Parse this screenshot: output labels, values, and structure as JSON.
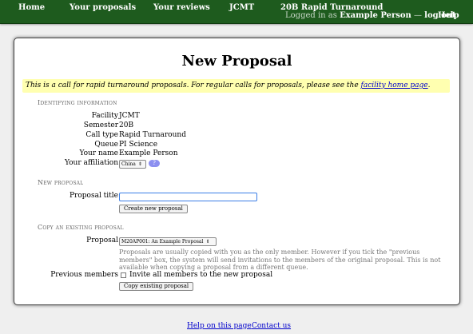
{
  "nav": {
    "home": "Home",
    "your_proposals": "Your proposals",
    "your_reviews": "Your reviews",
    "jcmt": "JCMT",
    "call_title": "20B Rapid Turnaround",
    "logged_in_prefix": "Logged in as",
    "user_name": "Example Person",
    "separator": "—",
    "log_out": "log out",
    "help": "Help"
  },
  "page": {
    "title": "New Proposal",
    "notice_text": "This is a call for rapid turnaround proposals. For regular calls for proposals, please see the",
    "notice_link": "facility home page",
    "notice_end": "."
  },
  "identifying": {
    "heading": "Identifying information",
    "rows": [
      {
        "label": "Facility",
        "value": "JCMT"
      },
      {
        "label": "Semester",
        "value": "20B"
      },
      {
        "label": "Call type",
        "value": "Rapid Turnaround"
      },
      {
        "label": "Queue",
        "value": "PI Science"
      },
      {
        "label": "Your name",
        "value": "Example Person"
      }
    ],
    "affiliation_label": "Your affiliation",
    "affiliation_value": "China",
    "help_label": "?"
  },
  "new_proposal": {
    "heading": "New proposal",
    "title_label": "Proposal title",
    "title_value": "",
    "create_button": "Create new proposal"
  },
  "copy": {
    "heading": "Copy an existing proposal",
    "proposal_label": "Proposal",
    "proposal_value": "M20AP001: An Example Proposal",
    "note": "Proposals are usually copied with you as the only member. However if you tick the \"previous members\" box, the system will send invitations to the members of the original proposal. This is not available when copying a proposal from a different queue.",
    "previous_members_label": "Previous members",
    "invite_label": "Invite all members to the new proposal",
    "copy_button": "Copy existing proposal"
  },
  "footer": {
    "help_link": "Help on this page",
    "contact_link": "Contact us"
  },
  "colors": {
    "nav_bg": "#1e5b1e",
    "notice_bg": "#ffffb0",
    "link": "#0000cc",
    "help_badge": "#8c8ff0"
  }
}
